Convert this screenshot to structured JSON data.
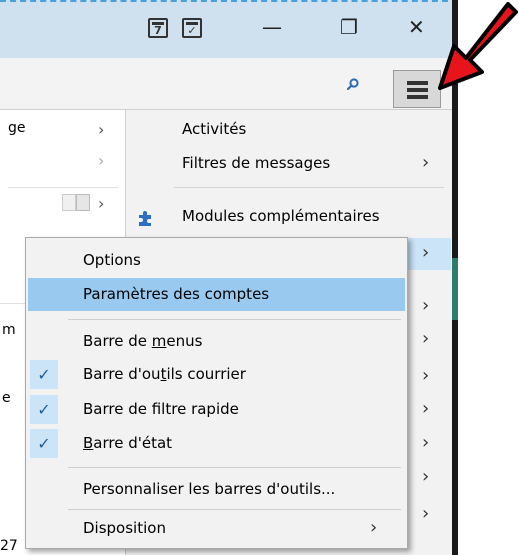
{
  "titlebar": {
    "calendar_day": "7",
    "minimize_glyph": "—",
    "restore_glyph": "❐",
    "close_glyph": "✕"
  },
  "left_panel": {
    "rows": [
      {
        "label": "ge",
        "chevron": "›"
      },
      {
        "label": "",
        "chevron": "›"
      },
      {
        "label": "",
        "chevron": "›"
      },
      {
        "label": "m",
        "chevron": ""
      },
      {
        "label": "e",
        "chevron": ""
      }
    ],
    "bottom_text": "27"
  },
  "main_menu": {
    "items": [
      {
        "label": "Activités",
        "chevron": ""
      },
      {
        "label": "Filtres de messages",
        "chevron": "›"
      },
      {
        "label": "Modules complémentaires",
        "chevron": ""
      },
      {
        "label": "",
        "chevron": "›"
      },
      {
        "label": "",
        "chevron": "›"
      },
      {
        "label": "",
        "chevron": "›"
      },
      {
        "label": "",
        "chevron": "›"
      },
      {
        "label": "",
        "chevron": "›"
      },
      {
        "label": "",
        "chevron": "›"
      },
      {
        "label": "",
        "chevron": "›"
      },
      {
        "label": "",
        "chevron": "›"
      }
    ]
  },
  "submenu": {
    "options": "Options",
    "account_settings": "Paramètres des comptes",
    "menu_bar_pre": "Barre de ",
    "menu_bar_u": "m",
    "menu_bar_post": "enus",
    "mail_toolbar_pre": "Barre d'ou",
    "mail_toolbar_u": "t",
    "mail_toolbar_post": "ils courrier",
    "quick_filter_bar": "Barre de filtre rapide",
    "status_bar_u": "B",
    "status_bar_post": "arre d'état",
    "customize_toolbars": "Personnaliser les barres d'outils...",
    "layout": "Disposition",
    "check_glyph": "✓",
    "chevron": "›"
  },
  "colors": {
    "highlight": "#99c9ef",
    "hover": "#cce4f7",
    "arrow": "#e8141b"
  }
}
